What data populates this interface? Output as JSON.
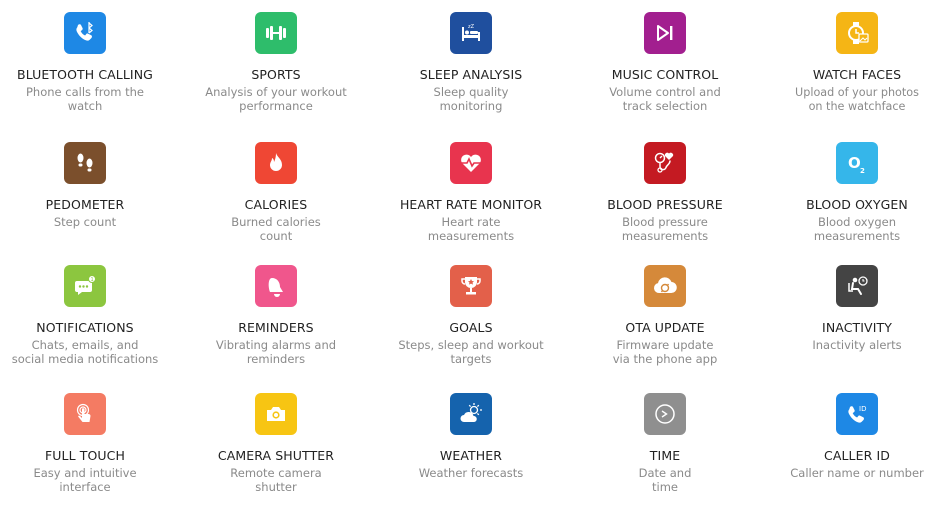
{
  "features": [
    {
      "title": "BLUETOOTH CALLING",
      "desc": "Phone calls from the\nwatch",
      "icon": "bluetooth-phone-icon",
      "color": "#1e88e5"
    },
    {
      "title": "SPORTS",
      "desc": "Analysis of your workout\nperformance",
      "icon": "dumbbell-icon",
      "color": "#2ebd6b"
    },
    {
      "title": "SLEEP ANALYSIS",
      "desc": "Sleep quality\nmonitoring",
      "icon": "bed-icon",
      "color": "#1f4f9e"
    },
    {
      "title": "MUSIC CONTROL",
      "desc": "Volume control and\ntrack selection",
      "icon": "play-next-icon",
      "color": "#a21f8f"
    },
    {
      "title": "WATCH FACES",
      "desc": "Upload of your photos\non the watchface",
      "icon": "watch-photo-icon",
      "color": "#f5b515"
    },
    {
      "title": "PEDOMETER",
      "desc": "Step count",
      "icon": "footprints-icon",
      "color": "#7b4f2c"
    },
    {
      "title": "CALORIES",
      "desc": "Burned calories\ncount",
      "icon": "flame-icon",
      "color": "#ef4734"
    },
    {
      "title": "HEART RATE MONITOR",
      "desc": "Heart rate\nmeasurements",
      "icon": "heart-pulse-icon",
      "color": "#e8344e"
    },
    {
      "title": "BLOOD PRESSURE",
      "desc": "Blood pressure\nmeasurements",
      "icon": "blood-pressure-icon",
      "color": "#c41a22"
    },
    {
      "title": "BLOOD OXYGEN",
      "desc": "Blood oxygen\nmeasurements",
      "icon": "oxygen-icon",
      "color": "#35b6ea"
    },
    {
      "title": "NOTIFICATIONS",
      "desc": "Chats, emails, and\nsocial media notifications",
      "icon": "chat-bubble-icon",
      "color": "#8cc63f"
    },
    {
      "title": "REMINDERS",
      "desc": "Vibrating alarms and\nreminders",
      "icon": "bell-icon",
      "color": "#f0568c"
    },
    {
      "title": "GOALS",
      "desc": "Steps, sleep and workout\ntargets",
      "icon": "trophy-icon",
      "color": "#e3604a"
    },
    {
      "title": "OTA UPDATE",
      "desc": "Firmware update\nvia the phone app",
      "icon": "cloud-sync-icon",
      "color": "#d5893a"
    },
    {
      "title": "INACTIVITY",
      "desc": "Inactivity alerts",
      "icon": "sitting-person-icon",
      "color": "#444444"
    },
    {
      "title": "FULL TOUCH",
      "desc": "Easy and intuitive\ninterface",
      "icon": "touch-finger-icon",
      "color": "#f47b63"
    },
    {
      "title": "CAMERA SHUTTER",
      "desc": "Remote camera\nshutter",
      "icon": "camera-icon",
      "color": "#f7c513"
    },
    {
      "title": "WEATHER",
      "desc": "Weather forecasts",
      "icon": "weather-icon",
      "color": "#1563ad"
    },
    {
      "title": "TIME",
      "desc": "Date and\ntime",
      "icon": "clock-icon",
      "color": "#8f8f8f"
    },
    {
      "title": "CALLER ID",
      "desc": "Caller name or number",
      "icon": "caller-id-icon",
      "color": "#1e88e5"
    }
  ]
}
